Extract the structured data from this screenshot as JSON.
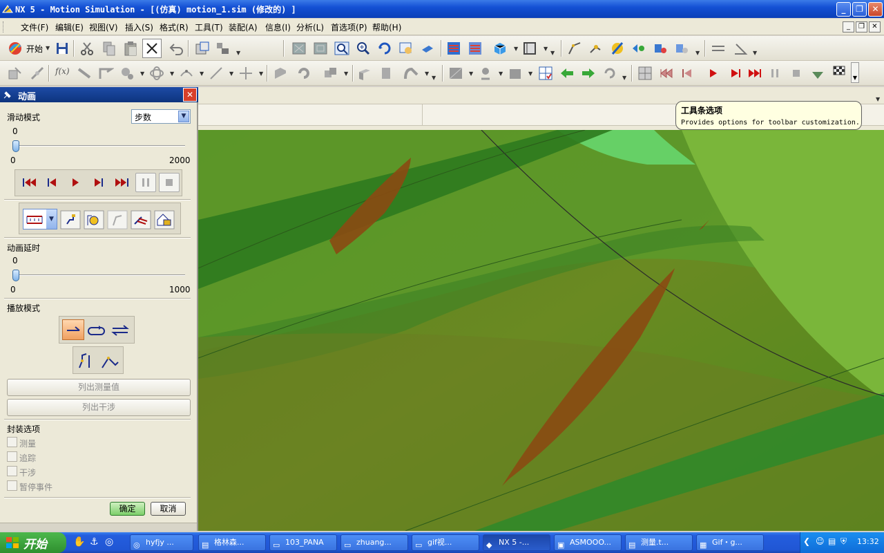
{
  "window": {
    "title": "NX 5 - Motion Simulation - [(仿真) motion_1.sim (修改的) ]",
    "min": "_",
    "max": "❐",
    "close": "✕"
  },
  "menu": [
    "文件(F)",
    "编辑(E)",
    "视图(V)",
    "插入(S)",
    "格式(R)",
    "工具(T)",
    "装配(A)",
    "信息(I)",
    "分析(L)",
    "首选项(P)",
    "帮助(H)"
  ],
  "toolbar": {
    "start_label": "开始"
  },
  "tooltip": {
    "title": "工具条选项",
    "text": "Provides options for toolbar customization."
  },
  "panel": {
    "title": "动画",
    "slide_mode_label": "滑动模式",
    "slide_mode_value": "步数",
    "slider1": {
      "value": "0",
      "min": "0",
      "max": "2000",
      "fraction": 0
    },
    "delay_label": "动画延时",
    "slider2": {
      "value": "0",
      "min": "0",
      "max": "1000",
      "fraction": 0
    },
    "playmode_label": "播放模式",
    "list_measure": "列出测量值",
    "list_interference": "列出干涉",
    "package_options": "封装选项",
    "checks": [
      "测量",
      "追踪",
      "干涉",
      "暂停事件"
    ],
    "ok": "确定",
    "cancel": "取消"
  },
  "taskbar": {
    "start": "开始",
    "tasks": [
      "hyfjy ...",
      "格林森...",
      "103_PANA",
      "zhuang...",
      "gif视...",
      "NX 5 -...",
      "ASMOOO...",
      "测量.t...",
      "Gif・g..."
    ],
    "clock": "13:32"
  },
  "colors": {
    "title_blue": "#0b3fb8",
    "panel_bg": "#ece9d8",
    "model_green": "#5c9a24",
    "interference_brown": "#8a4a12",
    "ok_green": "#3aa83a"
  }
}
